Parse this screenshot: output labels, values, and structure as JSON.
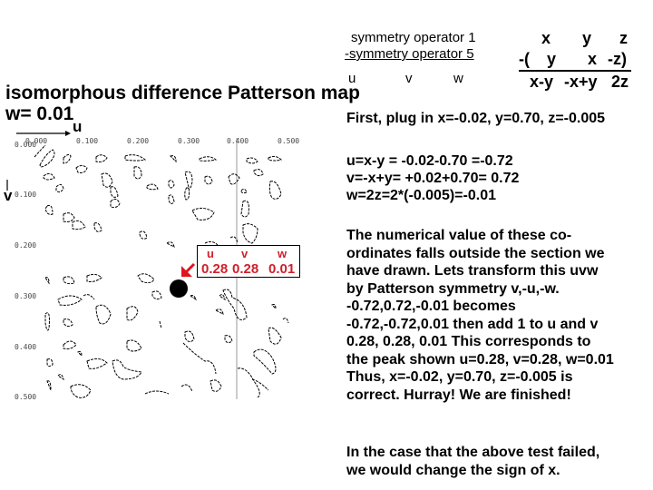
{
  "symmetry": {
    "op1_label": "symmetry operator 1",
    "op5_label": "-symmetry operator 5",
    "result_labels": [
      "u",
      "v",
      "w"
    ],
    "op1_values": [
      "x",
      "y",
      "z"
    ],
    "op5_prefix": "-(",
    "op5_values": [
      "y",
      "x",
      "-z)"
    ],
    "result_values": [
      "x-y",
      "-x+y",
      "2z"
    ]
  },
  "map": {
    "title": "isomorphous difference Patterson map",
    "section_label": "w= 0.01",
    "u_axis_label": "u",
    "v_axis_label": "v",
    "u_ticks": [
      "0.000",
      "0.100",
      "0.200",
      "0.300",
      "0.400",
      "0.500"
    ],
    "v_ticks": [
      "0.000",
      "0.100",
      "0.200",
      "0.300",
      "0.400",
      "0.500"
    ],
    "peak": {
      "headers": [
        "u",
        "v",
        "w"
      ],
      "values": [
        "0.28",
        "0.28",
        "0.01"
      ],
      "color": "#d0202a"
    }
  },
  "explanation": {
    "step1": "First, plug in x=-0.02, y=0.70, z=-0.005",
    "calc": [
      "u=x-y  = -0.02-0.70 =-0.72",
      "v=-x+y= +0.02+0.70= 0.72",
      "w=2z=2*(-0.005)=-0.01"
    ],
    "paragraph": [
      "The numerical value of these co-",
      "ordinates falls outside the section we",
      "have drawn.  Lets transform this uvw",
      "by Patterson symmetry v,-u,-w.",
      "-0.72,0.72,-0.01 becomes",
      "-0.72,-0.72,0.01 then add 1 to u and v",
      "0.28, 0.28, 0.01 This corresponds to",
      "the peak shown u=0.28, v=0.28, w=0.01",
      "Thus, x=-0.02, y=0.70, z=-0.005 is",
      "correct.  Hurray! We are finished!"
    ],
    "note": [
      "In the case that the above test failed,",
      "we would change the sign of x."
    ]
  }
}
